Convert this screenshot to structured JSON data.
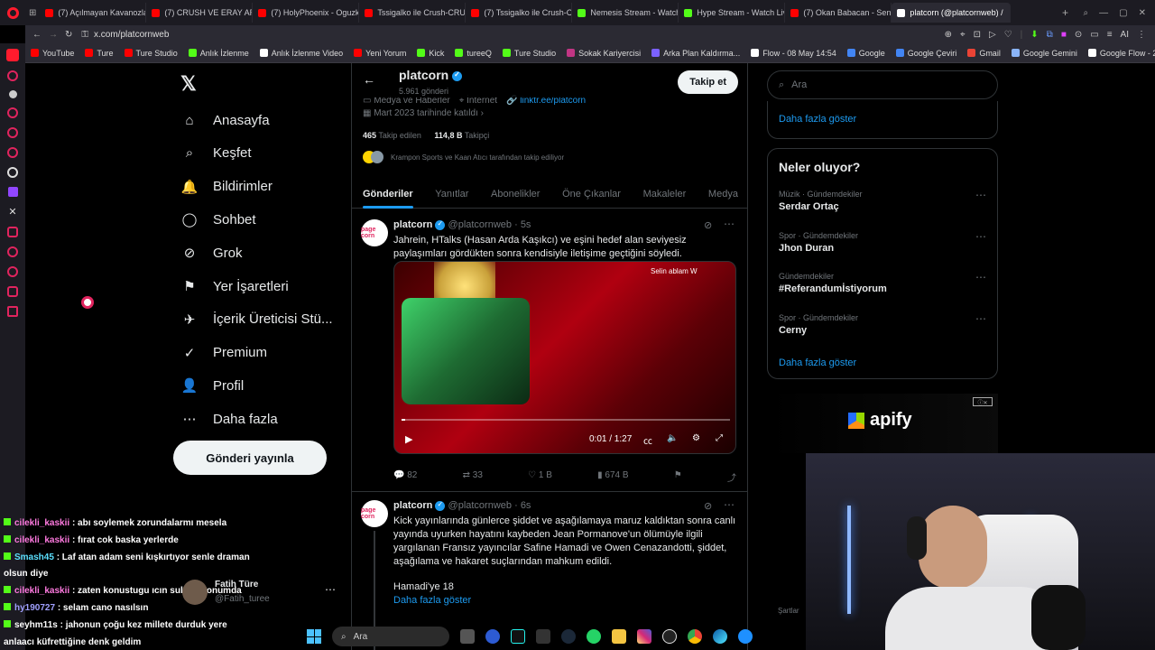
{
  "browser": {
    "tabs": [
      {
        "label": "(7) Açılmayan Kavanozlar",
        "color": "#ff0000"
      },
      {
        "label": "(7) CRUSH VE ERAY ARA",
        "color": "#ff0000"
      },
      {
        "label": "(7) HolyPhoenix - Oguzk",
        "color": "#ff0000"
      },
      {
        "label": "Tssigalko ile Crush-CRUS",
        "color": "#ff0000"
      },
      {
        "label": "(7) Tssigalko ile Crush-C",
        "color": "#ff0000"
      },
      {
        "label": "Nemesis Stream - Watch",
        "color": "#53fc18"
      },
      {
        "label": "Hype Stream - Watch Liv",
        "color": "#53fc18"
      },
      {
        "label": "(7) Okan Babacan - Sen",
        "color": "#ff0000"
      },
      {
        "label": "platcorn (@platcornweb) /",
        "color": "#ffffff",
        "active": true
      }
    ],
    "url": "x.com/platcornweb",
    "bookmarks": [
      "YouTube",
      "Ture",
      "Ture Studio",
      "Anlık İzlenme",
      "Anlık İzlenme Video",
      "Yeni Yorum",
      "Kick",
      "tureeQ",
      "Ture Studio",
      "Sokak Kariyercisi",
      "Arka Plan Kaldırma...",
      "Flow - 08 May 14:54",
      "Google",
      "Google Çeviri",
      "Gmail",
      "Google Gemini",
      "Google Flow - 22..."
    ]
  },
  "nav": {
    "items": [
      "Anasayfa",
      "Keşfet",
      "Bildirimler",
      "Sohbet",
      "Grok",
      "Yer İşaretleri",
      "İçerik Üreticisi Stü...",
      "Premium",
      "Profil",
      "Daha fazla"
    ],
    "post_button": "Gönderi yayınla"
  },
  "profile": {
    "name": "platcorn",
    "post_count": "5.961 gönderi",
    "follow_button": "Takip et",
    "category": "Medya ve Haberler",
    "location": "İnternet",
    "link": "linktr.ee/platcorn",
    "joined": "Mart 2023 tarihinde katıldı",
    "following_count": "465",
    "following_label": "Takip edilen",
    "followers_count": "114,8 B",
    "followers_label": "Takipçi",
    "followed_by": "Krampon Sports ve Kaan Atıcı tarafından takip ediliyor",
    "tabs": [
      "Gönderiler",
      "Yanıtlar",
      "Abonelikler",
      "Öne Çıkanlar",
      "Makaleler",
      "Medya"
    ]
  },
  "tweets": [
    {
      "avatar": "page corn",
      "name": "platcorn",
      "handle": "@platcornweb",
      "time": "5s",
      "text": "Jahrein, HTalks (Hasan Arda Kaşıkcı) ve eşini hedef alan seviyesiz paylaşımları gördükten sonra kendisiyle iletişime geçtiğini söyledi.",
      "video_caption": "Selin ablam W",
      "video_time": "0:01 / 1:27",
      "replies": "82",
      "reposts": "33",
      "likes": "1 B",
      "views": "674 B"
    },
    {
      "avatar": "page corn",
      "name": "platcorn",
      "handle": "@platcornweb",
      "time": "6s",
      "text": "Kick yayınlarında günlerce şiddet ve aşağılamaya maruz kaldıktan sonra canlı yayında uyurken hayatını kaybeden Jean Pormanove'un ölümüyle ilgili yargılanan Fransız yayıncılar Safine Hamadi ve Owen Cenazandotti, şiddet, aşağılama ve hakaret suçlarından mahkum edildi.",
      "text2": "Hamadi'ye 18",
      "show_more": "Daha fazla göster"
    }
  ],
  "right": {
    "search_placeholder": "Ara",
    "show_more_top": "Daha fazla göster",
    "trends_title": "Neler oluyor?",
    "trends": [
      {
        "category": "Müzik · Gündemdekiler",
        "name": "Serdar Ortaç"
      },
      {
        "category": "Spor · Gündemdekiler",
        "name": "Jhon Duran"
      },
      {
        "category": "Gündemdekiler",
        "name": "#Referandumİstiyorum"
      },
      {
        "category": "Spor · Gündemdekiler",
        "name": "Cerny"
      }
    ],
    "show_more_bottom": "Daha fazla göster",
    "ad_brand": "apify",
    "footer": "Şartlar"
  },
  "chat": [
    {
      "user": "cilekli_kaskii",
      "text": ": abı soylemek zorundalarmı mesela",
      "color": "#ff7ae0"
    },
    {
      "user": "cilekli_kaskii",
      "text": ": fırat cok baska yerlerde",
      "color": "#ff7ae0"
    },
    {
      "user": "Smash45",
      "text": ": Laf atan adam seni kışkırtıyor senle draman",
      "color": "#5be0ff"
    },
    {
      "user": "",
      "text": "olsun diye",
      "color": "#ffffff"
    },
    {
      "user": "cilekli_kaskii",
      "text": ": zaten konustugu ıcın sulfa o konumda",
      "color": "#ff7ae0"
    },
    {
      "user": "hy190727",
      "text": ": selam cano nasılsın",
      "color": "#a0a0ff"
    },
    {
      "user": "seyhm11s",
      "text": ": jahonun çoğu kez millete durduk yere",
      "color": "#ffffff"
    },
    {
      "user": "",
      "text": "anlaacı küfrettiğine denk geldim",
      "color": "#ffffff"
    }
  ],
  "account": {
    "name": "Fatih Türe",
    "handle": "@Fatih_turee"
  },
  "taskbar": {
    "search_placeholder": "Ara"
  }
}
